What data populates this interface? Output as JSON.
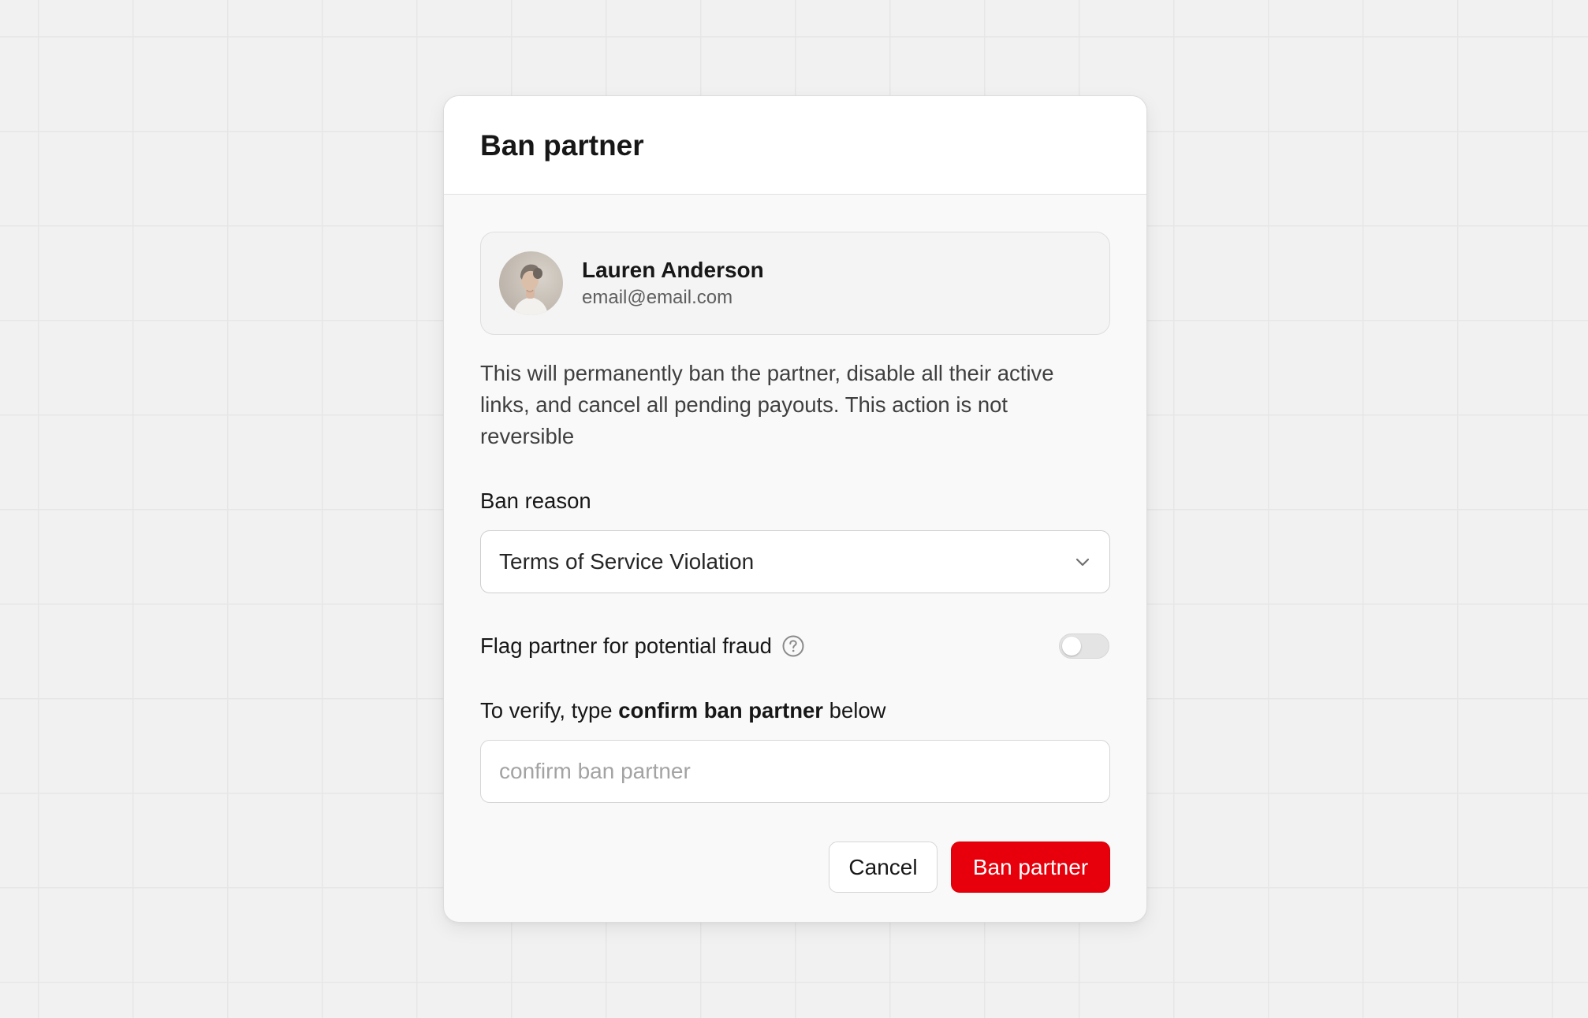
{
  "modal": {
    "title": "Ban partner"
  },
  "partner": {
    "name": "Lauren Anderson",
    "email": "email@email.com"
  },
  "warning": "This will permanently ban the partner, disable all their active links, and cancel all pending payouts. This action is not reversible",
  "ban_reason": {
    "label": "Ban reason",
    "selected": "Terms of Service Violation"
  },
  "fraud_flag": {
    "label": "Flag partner for potential fraud",
    "enabled": false
  },
  "verify": {
    "prefix": "To verify, type ",
    "phrase": "confirm ban partner",
    "suffix": " below",
    "placeholder": "confirm ban partner",
    "value": ""
  },
  "actions": {
    "cancel_label": "Cancel",
    "confirm_label": "Ban partner"
  },
  "icons": {
    "select": "chevron-down-icon",
    "help": "question-circle-icon"
  },
  "colors": {
    "danger": "#e7000b",
    "background": "#f1f1f1",
    "grid_line": "#e6e6e6"
  }
}
